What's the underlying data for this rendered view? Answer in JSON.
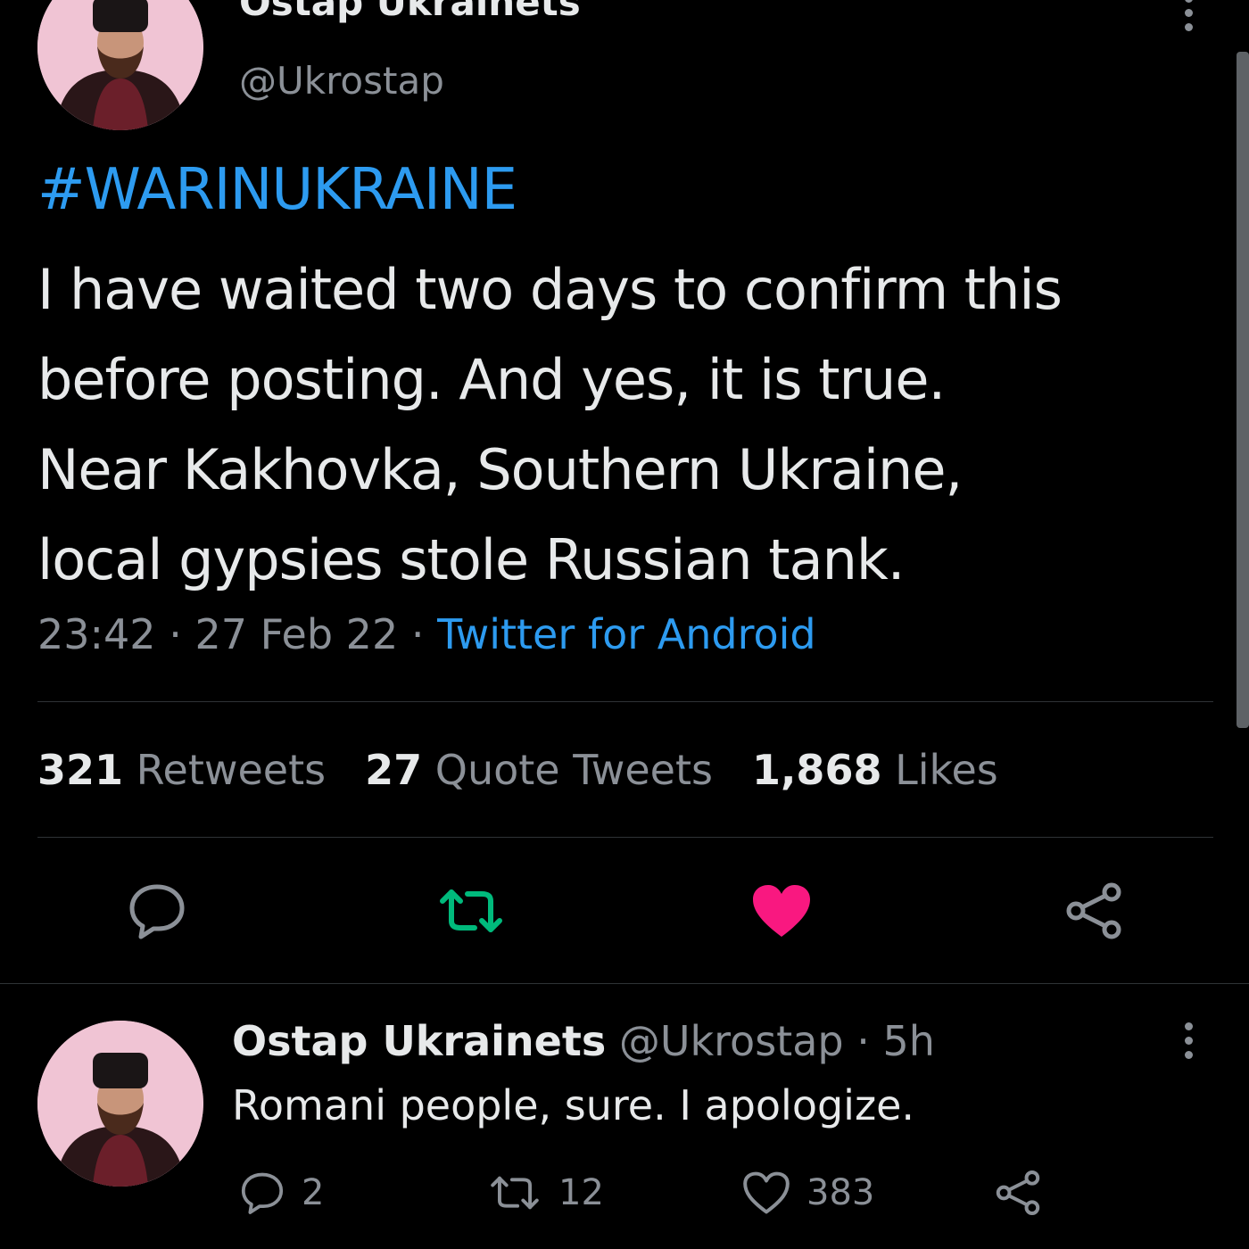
{
  "tweet": {
    "author_name": "Ostap Ukrainets",
    "author_handle": "@Ukrostap",
    "hashtag": "#WARINUKRAINE",
    "text_lines": [
      "I have waited two days to confirm this",
      "before posting. And yes, it is true.",
      "Near Kakhovka, Southern Ukraine,",
      "local gypsies stole Russian tank."
    ],
    "time": "23:42",
    "date": "27 Feb 22",
    "separator": "·",
    "source": "Twitter for Android",
    "stats": {
      "retweets_count": "321",
      "retweets_label": "Retweets",
      "quotes_count": "27",
      "quotes_label": "Quote Tweets",
      "likes_count": "1,868",
      "likes_label": "Likes"
    }
  },
  "reply": {
    "author_name": "Ostap Ukrainets",
    "author_handle": "@Ukrostap",
    "separator": "·",
    "age": "5h",
    "text": "Romani people, sure. I apologize.",
    "reply_count": "2",
    "retweet_count": "12",
    "like_count": "383"
  },
  "colors": {
    "background": "#000000",
    "text": "#e7e9ea",
    "muted": "#8b9097",
    "link_blue": "#2d9bf0",
    "retweet_green": "#00ba7c",
    "like_pink": "#f91880"
  },
  "icons": {
    "more": "more-vertical-icon",
    "reply": "reply-bubble-icon",
    "retweet": "retweet-icon",
    "like": "heart-icon",
    "share": "share-icon"
  }
}
